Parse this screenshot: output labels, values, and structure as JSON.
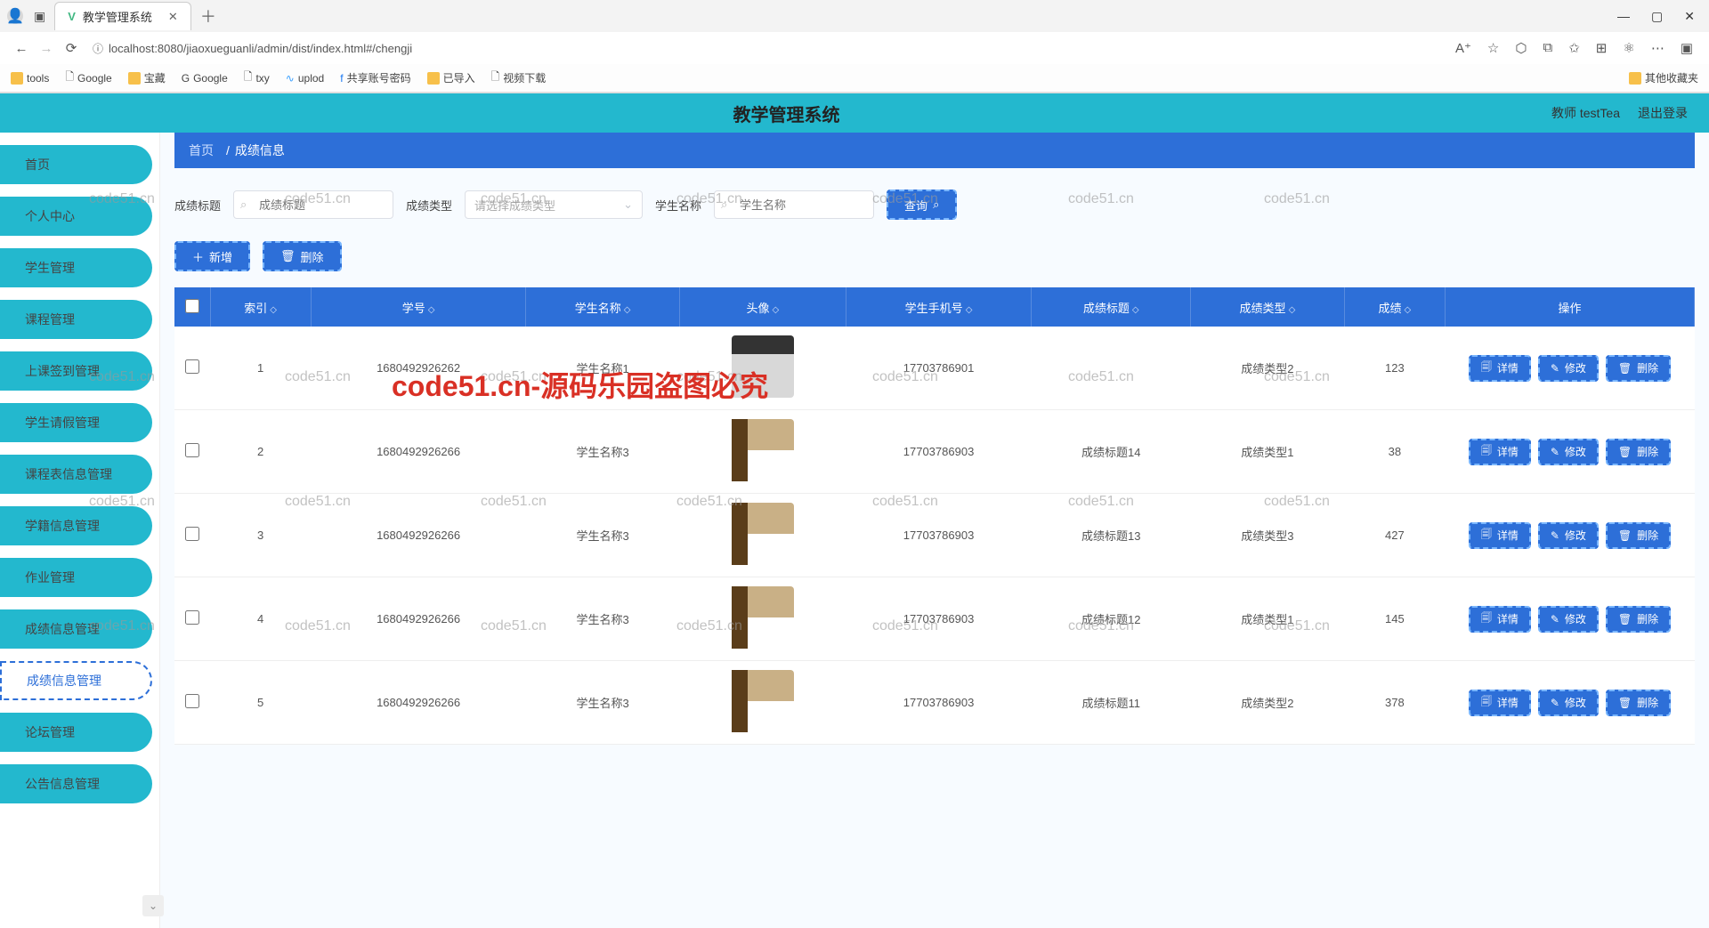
{
  "browser": {
    "tab_title": "教学管理系统",
    "url": "localhost:8080/jiaoxueguanli/admin/dist/index.html#/chengji",
    "bookmarks": [
      "tools",
      "Google",
      "宝藏",
      "Google",
      "txy",
      "uplod",
      "共享账号密码",
      "已导入",
      "视频下载"
    ],
    "other_fav": "其他收藏夹"
  },
  "header": {
    "title": "教学管理系统",
    "user": "教师 testTea",
    "logout": "退出登录"
  },
  "sidebar": {
    "items": [
      "首页",
      "个人中心",
      "学生管理",
      "课程管理",
      "上课签到管理",
      "学生请假管理",
      "课程表信息管理",
      "学籍信息管理",
      "作业管理",
      "成绩信息管理",
      "成绩信息管理",
      "论坛管理",
      "公告信息管理"
    ],
    "active_index": 10
  },
  "crumb": {
    "home": "首页",
    "current": "成绩信息"
  },
  "filters": {
    "label_title": "成绩标题",
    "ph_title": "成绩标题",
    "label_type": "成绩类型",
    "ph_type": "请选择成绩类型",
    "label_student": "学生名称",
    "ph_student": "学生名称",
    "query": "查询"
  },
  "actions": {
    "add": "新增",
    "delete": "删除"
  },
  "table": {
    "cols": [
      "索引",
      "学号",
      "学生名称",
      "头像",
      "学生手机号",
      "成绩标题",
      "成绩类型",
      "成绩",
      "操作"
    ],
    "row_actions": [
      "详情",
      "修改",
      "删除"
    ],
    "rows": [
      {
        "idx": "1",
        "sno": "1680492926262",
        "name": "学生名称1",
        "avatar": "person",
        "phone": "17703786901",
        "title": "",
        "type": "成绩类型2",
        "score": "123"
      },
      {
        "idx": "2",
        "sno": "1680492926266",
        "name": "学生名称3",
        "avatar": "cat",
        "phone": "17703786903",
        "title": "成绩标题14",
        "type": "成绩类型1",
        "score": "38"
      },
      {
        "idx": "3",
        "sno": "1680492926266",
        "name": "学生名称3",
        "avatar": "cat",
        "phone": "17703786903",
        "title": "成绩标题13",
        "type": "成绩类型3",
        "score": "427"
      },
      {
        "idx": "4",
        "sno": "1680492926266",
        "name": "学生名称3",
        "avatar": "cat",
        "phone": "17703786903",
        "title": "成绩标题12",
        "type": "成绩类型1",
        "score": "145"
      },
      {
        "idx": "5",
        "sno": "1680492926266",
        "name": "学生名称3",
        "avatar": "cat",
        "phone": "17703786903",
        "title": "成绩标题11",
        "type": "成绩类型2",
        "score": "378"
      }
    ]
  },
  "watermark_text": "code51.cn",
  "big_watermark": "code51.cn-源码乐园盗图必究"
}
